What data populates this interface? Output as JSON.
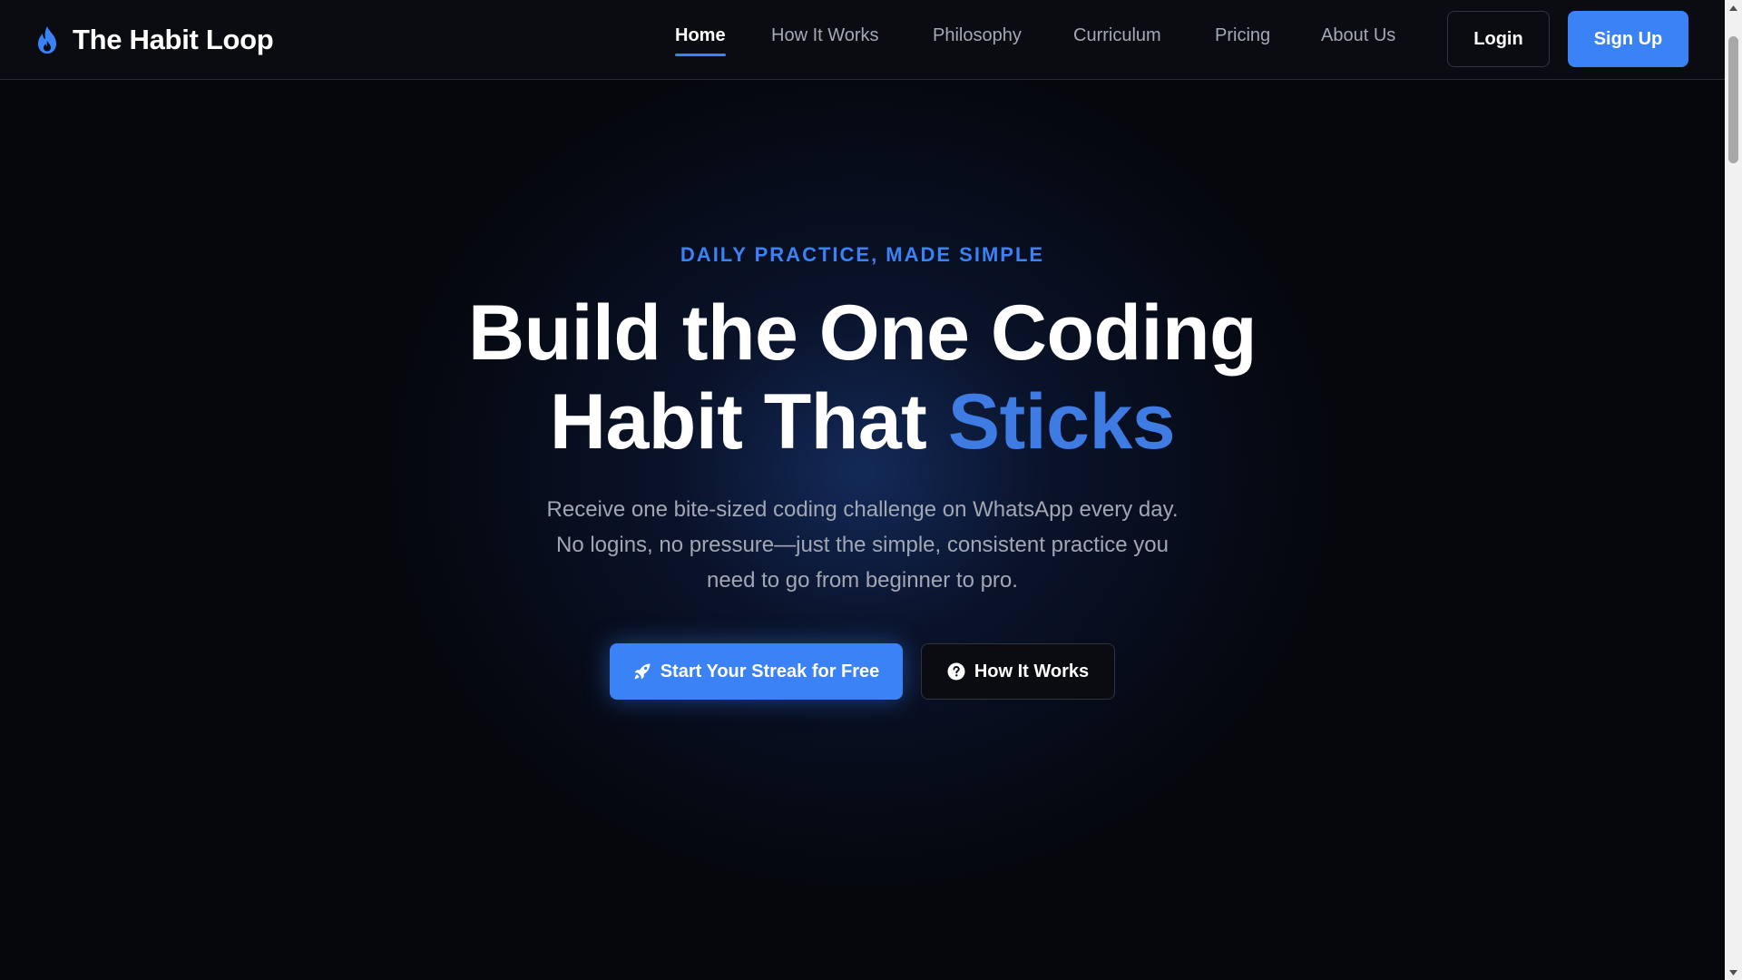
{
  "brand": {
    "name": "The Habit Loop",
    "logo_icon": "flame-icon",
    "accent_color": "#3b82f6"
  },
  "nav": {
    "links": [
      {
        "label": "Home",
        "active": true
      },
      {
        "label": "How It Works",
        "active": false
      },
      {
        "label": "Philosophy",
        "active": false
      },
      {
        "label": "Curriculum",
        "active": false
      },
      {
        "label": "Pricing",
        "active": false
      },
      {
        "label": "About Us",
        "active": false
      }
    ],
    "login_label": "Login",
    "signup_label": "Sign Up"
  },
  "hero": {
    "eyebrow": "DAILY PRACTICE, MADE SIMPLE",
    "headline_line1": "Build the One Coding",
    "headline_line2_prefix": "Habit That",
    "headline_accent": "Sticks",
    "subtext_line1": "Receive one bite-sized coding challenge on WhatsApp every day.",
    "subtext_line2": "No logins, no pressure—just the simple, consistent practice you",
    "subtext_line3": "need to go from beginner to pro.",
    "primary_cta": {
      "label": "Start Your Streak for Free",
      "icon": "rocket-icon"
    },
    "secondary_cta": {
      "label": "How It Works",
      "icon": "question-circle-icon"
    }
  },
  "colors": {
    "background": "#05070d",
    "primary": "#3b82f6",
    "muted_text": "#a1a7b3"
  }
}
